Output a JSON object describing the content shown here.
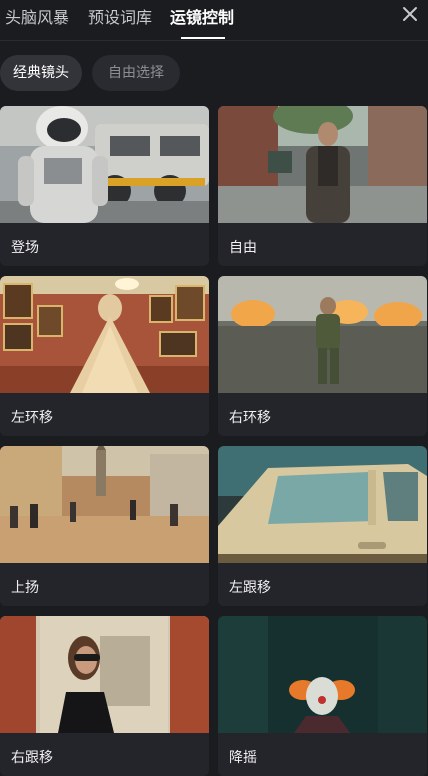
{
  "tabs": [
    {
      "label": "头脑风暴"
    },
    {
      "label": "预设词库"
    },
    {
      "label": "运镜控制"
    }
  ],
  "chips": {
    "classic": "经典镜头",
    "free": "自由选择"
  },
  "cards": [
    {
      "label": "登场"
    },
    {
      "label": "自由"
    },
    {
      "label": "左环移"
    },
    {
      "label": "右环移"
    },
    {
      "label": "上扬"
    },
    {
      "label": "左跟移"
    },
    {
      "label": "右跟移"
    },
    {
      "label": "降摇"
    }
  ],
  "icons": {
    "close": "close-icon"
  }
}
